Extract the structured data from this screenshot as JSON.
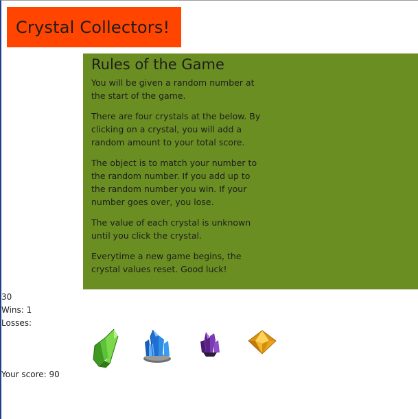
{
  "header": {
    "title": "Crystal Collectors!",
    "title_bg": "#ff4500"
  },
  "rules": {
    "heading": "Rules of the Game",
    "bg": "#6b8e23",
    "paragraphs": [
      "You will be given a random number at the start of the game.",
      "There are four crystals at the below. By clicking on a crystal, you will add a random amount to your total score.",
      "The object is to match your number to the random number. If you add up to the random number you win. If your number goes over, you lose.",
      "The value of each crystal is unknown until you click the crystal.",
      "Everytime a new game begins, the crystal values reset. Good luck!"
    ]
  },
  "stats": {
    "target_number": "30",
    "wins_text": "Wins: 1",
    "losses_text": "Losses:"
  },
  "crystals": [
    {
      "name": "green-crystal-icon",
      "color": "#4caf2a"
    },
    {
      "name": "blue-crystal-icon",
      "color": "#2a7fd4"
    },
    {
      "name": "purple-crystal-icon",
      "color": "#6a2c9a"
    },
    {
      "name": "yellow-crystal-icon",
      "color": "#e8a317"
    }
  ],
  "score": {
    "text": "Your score: 90"
  }
}
